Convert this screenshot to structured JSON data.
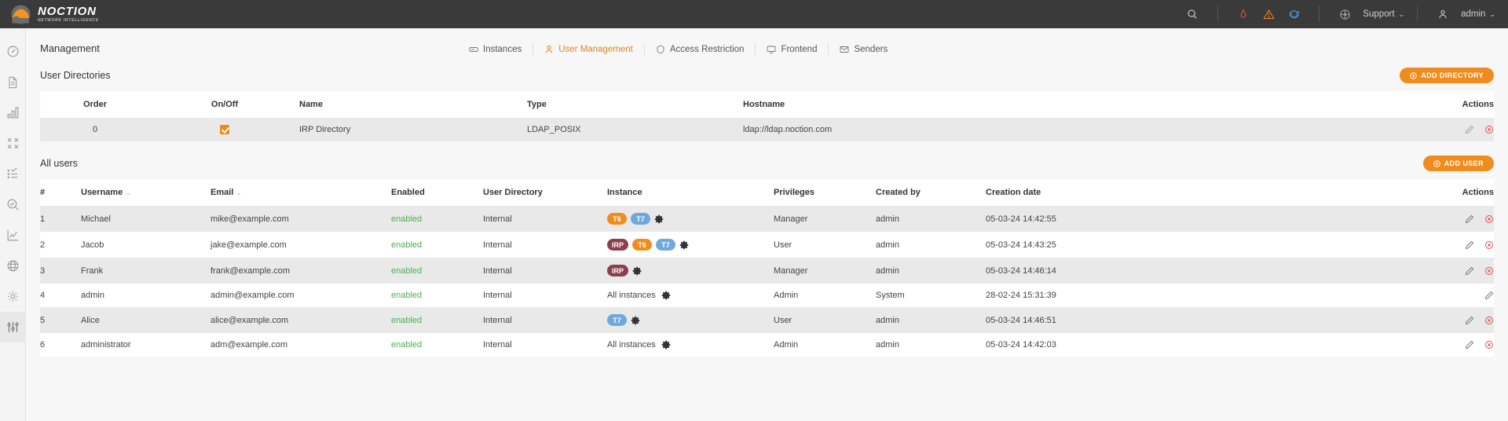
{
  "brand": {
    "name": "NOCTION",
    "tagline": "NETWORK INTELLIGENCE",
    "accent": "#f08c1e"
  },
  "topbar": {
    "icons": [
      {
        "name": "search-icon",
        "glyph": "search"
      },
      {
        "name": "flame-icon",
        "glyph": "flame",
        "color": "#e8513a"
      },
      {
        "name": "warning-triangle-icon",
        "glyph": "warning",
        "color": "#e8821e"
      },
      {
        "name": "chat-bubble-icon",
        "glyph": "chat",
        "color": "#4a90d9"
      }
    ],
    "support": {
      "label": "Support",
      "icon": "lifebuoy-icon",
      "chevron": "⌄"
    },
    "user": {
      "label": "admin",
      "icon": "person-icon",
      "chevron": "⌄"
    }
  },
  "sidebar": {
    "items": [
      {
        "name": "dashboard",
        "icon": "gauge-icon"
      },
      {
        "name": "reports",
        "icon": "document-icon"
      },
      {
        "name": "statistics",
        "icon": "bar-chart-icon"
      },
      {
        "name": "improvements",
        "icon": "compress-arrows-icon"
      },
      {
        "name": "events",
        "icon": "checklist-icon"
      },
      {
        "name": "troubleshooting",
        "icon": "search-circle-icon"
      },
      {
        "name": "graphs",
        "icon": "line-graph-icon"
      },
      {
        "name": "network",
        "icon": "globe-icon"
      },
      {
        "name": "configuration",
        "icon": "gear-icon"
      },
      {
        "name": "management",
        "icon": "sliders-icon",
        "active": true
      }
    ]
  },
  "page": {
    "title": "Management",
    "tabs": [
      {
        "label": "Instances",
        "icon": "server-icon",
        "active": false
      },
      {
        "label": "User Management",
        "icon": "user-icon",
        "active": true
      },
      {
        "label": "Access Restriction",
        "icon": "shield-icon",
        "active": false
      },
      {
        "label": "Frontend",
        "icon": "monitor-icon",
        "active": false
      },
      {
        "label": "Senders",
        "icon": "envelope-icon",
        "active": false
      }
    ]
  },
  "user_directories": {
    "title": "User Directories",
    "add_button": "ADD DIRECTORY",
    "columns": [
      "",
      "Order",
      "On/Off",
      "Name",
      "Type",
      "Hostname",
      "Actions"
    ],
    "rows": [
      {
        "order": "0",
        "on": true,
        "name": "IRP Directory",
        "type": "LDAP_POSIX",
        "hostname": "ldap://ldap.noction.com",
        "actions": [
          "edit-icon",
          "delete-icon"
        ]
      }
    ]
  },
  "all_users": {
    "title": "All users",
    "add_button": "ADD USER",
    "columns": [
      "#",
      "Username",
      "Email",
      "Enabled",
      "User Directory",
      "Instance",
      "Privileges",
      "Created by",
      "Creation date",
      "Actions"
    ],
    "sortable": [
      "Username",
      "Email"
    ],
    "rows": [
      {
        "num": "1",
        "username": "Michael",
        "email": "mike@example.com",
        "enabled": "enabled",
        "directory": "Internal",
        "instances": [
          {
            "label": "T6",
            "color": "#f08c1e"
          },
          {
            "label": "T7",
            "color": "#6fa8dc"
          }
        ],
        "instance_text": "",
        "privileges": "Manager",
        "created_by": "admin",
        "creation_date": "05-03-24 14:42:55",
        "actions": [
          "edit-icon",
          "delete-icon"
        ]
      },
      {
        "num": "2",
        "username": "Jacob",
        "email": "jake@example.com",
        "enabled": "enabled",
        "directory": "Internal",
        "instances": [
          {
            "label": "IRP",
            "color": "#8c3f4d"
          },
          {
            "label": "T6",
            "color": "#f08c1e"
          },
          {
            "label": "T7",
            "color": "#6fa8dc"
          }
        ],
        "instance_text": "",
        "privileges": "User",
        "created_by": "admin",
        "creation_date": "05-03-24 14:43:25",
        "actions": [
          "edit-icon",
          "delete-icon"
        ]
      },
      {
        "num": "3",
        "username": "Frank",
        "email": "frank@example.com",
        "enabled": "enabled",
        "directory": "Internal",
        "instances": [
          {
            "label": "IRP",
            "color": "#8c3f4d"
          }
        ],
        "instance_text": "",
        "privileges": "Manager",
        "created_by": "admin",
        "creation_date": "05-03-24 14:46:14",
        "actions": [
          "edit-icon",
          "delete-icon"
        ]
      },
      {
        "num": "4",
        "username": "admin",
        "email": "admin@example.com",
        "enabled": "enabled",
        "directory": "Internal",
        "instances": [],
        "instance_text": "All instances",
        "privileges": "Admin",
        "created_by": "System",
        "creation_date": "28-02-24 15:31:39",
        "actions": [
          "edit-icon"
        ]
      },
      {
        "num": "5",
        "username": "Alice",
        "email": "alice@example.com",
        "enabled": "enabled",
        "directory": "Internal",
        "instances": [
          {
            "label": "T7",
            "color": "#6fa8dc"
          }
        ],
        "instance_text": "",
        "privileges": "User",
        "created_by": "admin",
        "creation_date": "05-03-24 14:46:51",
        "actions": [
          "edit-icon",
          "delete-icon"
        ]
      },
      {
        "num": "6",
        "username": "administrator",
        "email": "adm@example.com",
        "enabled": "enabled",
        "directory": "Internal",
        "instances": [],
        "instance_text": "All instances",
        "privileges": "Admin",
        "created_by": "admin",
        "creation_date": "05-03-24 14:42:03",
        "actions": [
          "edit-icon",
          "delete-icon"
        ]
      }
    ]
  }
}
